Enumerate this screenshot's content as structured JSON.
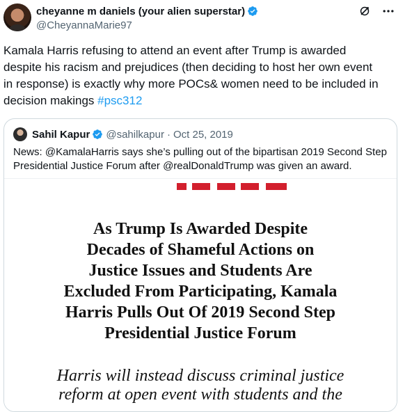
{
  "tweet": {
    "author_name": "cheyanne m daniels (your alien superstar)",
    "author_handle": "@CheyannaMarie97",
    "text_before_hashtag": "Kamala Harris refusing to attend an event after Trump is awarded despite his racism and prejudices (then deciding to host her own event in response) is exactly why more POCs& women need to be included in decision makings ",
    "hashtag": "#psc312"
  },
  "actions": {
    "grok_icon": "slashed-circle-icon",
    "more_icon": "more-horizontal-icon"
  },
  "quote": {
    "author_name": "Sahil Kapur",
    "author_handle": "@sahilkapur",
    "separator": "·",
    "date": "Oct 25, 2019",
    "text": "News: @KamalaHarris says she’s pulling out of the bipartisan 2019 Second Step Presidential Justice Forum after @realDonaldTrump was given an award.",
    "media": {
      "headline": "As Trump Is Awarded Despite\nDecades of Shameful Actions on\nJustice Issues and Students Are\nExcluded From Participating, Kamala\nHarris Pulls Out Of 2019 Second Step\nPresidential Justice Forum",
      "subheadline": "Harris will instead discuss criminal justice\nreform at open event with students and the"
    }
  },
  "colors": {
    "verified_badge": "#1d9bf0",
    "hashtag": "#1d9bf0",
    "secondary_text": "#536471",
    "card_border": "#cfd9de"
  }
}
